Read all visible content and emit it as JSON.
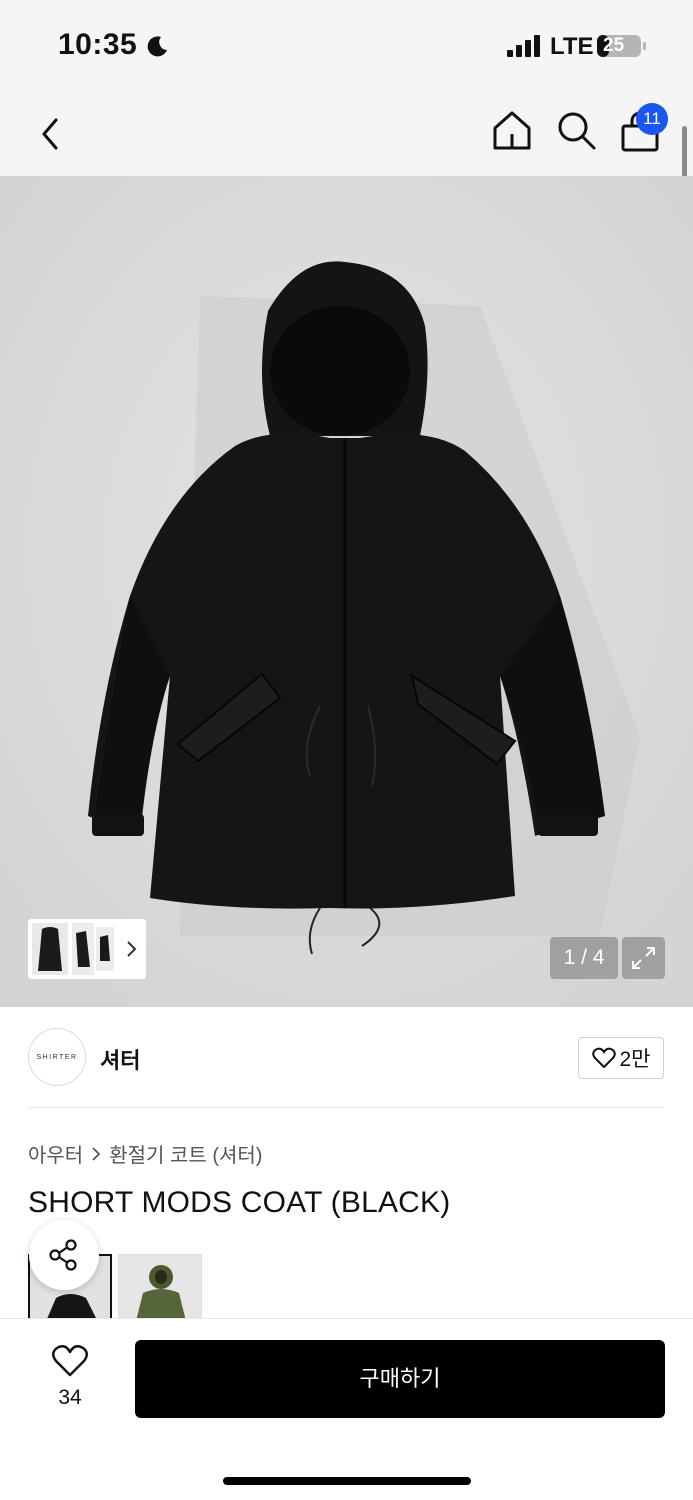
{
  "status_bar": {
    "time": "10:35",
    "network": "LTE",
    "battery": "25",
    "icons": [
      "moon-icon",
      "signal-icon",
      "battery-icon"
    ]
  },
  "nav": {
    "icons": [
      "back-icon",
      "home-icon",
      "search-icon",
      "cart-icon"
    ],
    "cart_count": "11"
  },
  "gallery": {
    "counter": "1 / 4",
    "expand_icon": "expand-icon",
    "thumbnail_chevron_icon": "chevron-right-icon"
  },
  "brand": {
    "logo_text": "SHIRTER",
    "name": "셔터",
    "likes": "2만"
  },
  "product": {
    "breadcrumb": [
      "아우터",
      "환절기 코트 (셔터)"
    ],
    "title": "SHORT MODS COAT (BLACK)"
  },
  "bottom": {
    "favorite_count": "34",
    "buy_label": "구매하기"
  },
  "colors": {
    "badge": "#1a56f0",
    "buy_button": "#000000",
    "hero_bg": "#dcdcde"
  }
}
